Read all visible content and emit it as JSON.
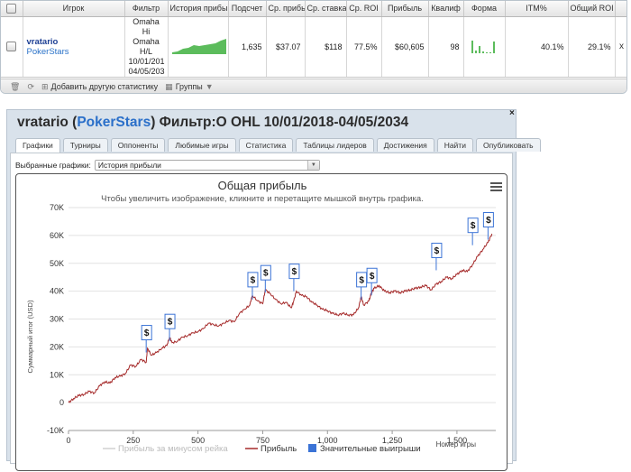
{
  "stats_table": {
    "headers": [
      "Игрок",
      "Фильтр",
      "История прибы",
      "Подсчет",
      "Ср. прибь",
      "Ср. ставка",
      "Ср. ROI",
      "Прибыль",
      "Квалиф",
      "Форма",
      "ITM%",
      "Общий ROI"
    ],
    "row": {
      "player": "vratario",
      "site": "PokerStars",
      "filter_lines": [
        "Omaha",
        "Hi",
        "Omaha",
        "H/L",
        "10/01/201",
        "04/05/203"
      ],
      "count": "1,635",
      "avg_profit": "$37.07",
      "avg_stake": "$118",
      "avg_roi": "77.5%",
      "profit": "$60,605",
      "qualifier": "98",
      "itm": "40.1%",
      "total_roi": "29.1%",
      "remove": "x"
    },
    "toolbar": {
      "add_label": "Добавить другую статистику",
      "groups_label": "Группы"
    }
  },
  "dialog": {
    "title_player": "vratario",
    "title_site": "PokerStars",
    "title_rest": "Фильтр:О OHL 10/01/2018-04/05/2034",
    "close": "×",
    "tabs": [
      "Графики",
      "Турниры",
      "Оппоненты",
      "Любимые игры",
      "Статистика",
      "Таблицы лидеров",
      "Достижения",
      "Найти",
      "Опубликовать"
    ],
    "active_tab": 0,
    "chart_select_label": "Выбранные графики:",
    "chart_select_value": "История прибыли"
  },
  "chart_data": {
    "type": "line",
    "title": "Общая прибыль",
    "subtitle": "Чтобы увеличить изображение, кликните и перетащите мышкой внутрь графика.",
    "xlabel": "Номер игры",
    "ylabel": "Суммарный итог (USD)",
    "xlim": [
      0,
      1650
    ],
    "ylim": [
      -10000,
      70000
    ],
    "x_ticks": [
      "0",
      "250",
      "500",
      "750",
      "1,000",
      "1,250",
      "1,500"
    ],
    "y_ticks": [
      "-10K",
      "0",
      "10K",
      "20K",
      "30K",
      "40K",
      "50K",
      "60K",
      "70K"
    ],
    "grid": true,
    "legend_position": "bottom",
    "legend": [
      "Прибыль за минусом рейка",
      "Прибыль",
      "Значительные выигрыши"
    ],
    "colors": {
      "rake_line": "#d0d0d0",
      "profit_line": "#a52a2a",
      "big_win": "#3b73d6"
    },
    "series": [
      {
        "name": "Прибыль",
        "x": [
          0,
          20,
          40,
          60,
          80,
          100,
          120,
          140,
          160,
          180,
          200,
          220,
          240,
          260,
          280,
          300,
          305,
          320,
          340,
          360,
          380,
          390,
          400,
          420,
          440,
          460,
          480,
          500,
          520,
          540,
          560,
          580,
          600,
          620,
          640,
          660,
          680,
          700,
          710,
          730,
          750,
          760,
          780,
          800,
          820,
          840,
          860,
          870,
          880,
          900,
          920,
          940,
          960,
          980,
          1000,
          1020,
          1040,
          1060,
          1080,
          1100,
          1120,
          1130,
          1140,
          1160,
          1170,
          1180,
          1200,
          1220,
          1240,
          1260,
          1280,
          1300,
          1320,
          1340,
          1360,
          1380,
          1400,
          1420,
          1440,
          1460,
          1480,
          1500,
          1520,
          1540,
          1560,
          1580,
          1600,
          1620,
          1635
        ],
        "values": [
          0,
          1500,
          2500,
          3000,
          4000,
          3500,
          6000,
          7500,
          7000,
          9000,
          9500,
          10500,
          13500,
          13000,
          15500,
          14500,
          19500,
          17000,
          18000,
          19500,
          20500,
          23500,
          21500,
          22000,
          23500,
          24000,
          25000,
          25500,
          26500,
          28500,
          28000,
          27500,
          28500,
          29500,
          29000,
          32000,
          33500,
          35000,
          38500,
          36500,
          35500,
          40500,
          39000,
          37000,
          35500,
          36000,
          34000,
          36500,
          40000,
          38500,
          38000,
          36000,
          35000,
          33500,
          33000,
          32000,
          31500,
          32000,
          31500,
          31500,
          34000,
          38000,
          35000,
          36500,
          39500,
          41000,
          42000,
          40000,
          39500,
          40000,
          39500,
          40000,
          40500,
          41000,
          41500,
          42000,
          40500,
          42500,
          43500,
          45000,
          44500,
          46000,
          47500,
          47000,
          49500,
          52500,
          55000,
          57500,
          60605
        ]
      }
    ],
    "big_wins": [
      {
        "x": 300,
        "y": 18000
      },
      {
        "x": 390,
        "y": 22000
      },
      {
        "x": 710,
        "y": 37000
      },
      {
        "x": 760,
        "y": 39500
      },
      {
        "x": 870,
        "y": 40000
      },
      {
        "x": 1130,
        "y": 37000
      },
      {
        "x": 1170,
        "y": 38500
      },
      {
        "x": 1420,
        "y": 47500
      },
      {
        "x": 1560,
        "y": 56500
      },
      {
        "x": 1620,
        "y": 58500
      }
    ],
    "big_win_label": "$"
  }
}
